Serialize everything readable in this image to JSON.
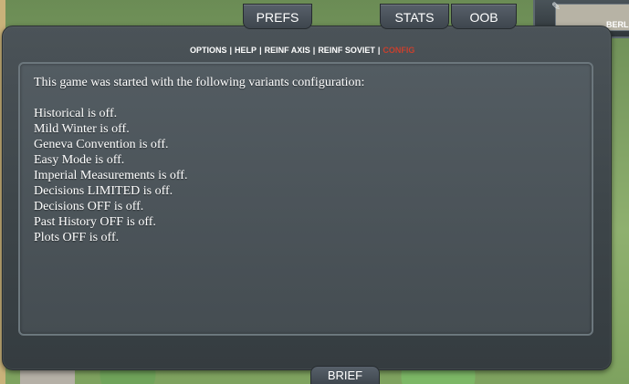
{
  "tabs": {
    "prefs": "PREFS",
    "stats": "STATS",
    "oob": "OOB"
  },
  "minimap": {
    "label": "BERL"
  },
  "submenu": {
    "items": [
      "OPTIONS",
      "HELP",
      "REINF AXIS",
      "REINF SOVIET",
      "CONFIG"
    ],
    "separator": "|",
    "active": "CONFIG",
    "active_color": "#c8402e"
  },
  "content": {
    "intro": "This game was started with the following variants configuration:",
    "lines": [
      "Historical is off.",
      "Mild Winter is off.",
      "Geneva Convention is off.",
      "Easy Mode is off.",
      "Imperial Measurements is off.",
      "Decisions LIMITED is off.",
      "Decisions OFF is off.",
      "Past History OFF is off.",
      "Plots OFF is off."
    ]
  },
  "bottom_tab": {
    "label": "BRIEF"
  }
}
